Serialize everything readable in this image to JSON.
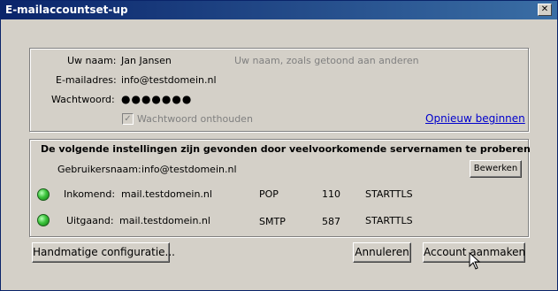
{
  "window": {
    "title": "E-mailaccountset-up",
    "close_glyph": "✕"
  },
  "account": {
    "name_label": "Uw naam:",
    "name_value": "Jan Jansen",
    "name_hint": "Uw naam, zoals getoond aan anderen",
    "email_label": "E-mailadres:",
    "email_value": "info@testdomein.nl",
    "password_label": "Wachtwoord:",
    "password_value": "●●●●●●●",
    "remember_label": "Wachtwoord onthouden",
    "remember_checked": true,
    "restart_link": "Opnieuw beginnen"
  },
  "settings": {
    "heading": "De volgende instellingen zijn gevonden door veelvoorkomende servernamen te proberen",
    "username_label": "Gebruikersnaam:",
    "username_value": "info@testdomein.nl",
    "edit_button": "Bewerken",
    "incoming": {
      "label": "Inkomend:",
      "server": "mail.testdomein.nl",
      "protocol": "POP",
      "port": "110",
      "security": "STARTTLS",
      "status_color": "#2fb52f"
    },
    "outgoing": {
      "label": "Uitgaand:",
      "server": "mail.testdomein.nl",
      "protocol": "SMTP",
      "port": "587",
      "security": "STARTTLS",
      "status_color": "#2fb52f"
    }
  },
  "buttons": {
    "manual": "Handmatige configuratie...",
    "cancel": "Annuleren",
    "create": "Account aanmaken"
  }
}
